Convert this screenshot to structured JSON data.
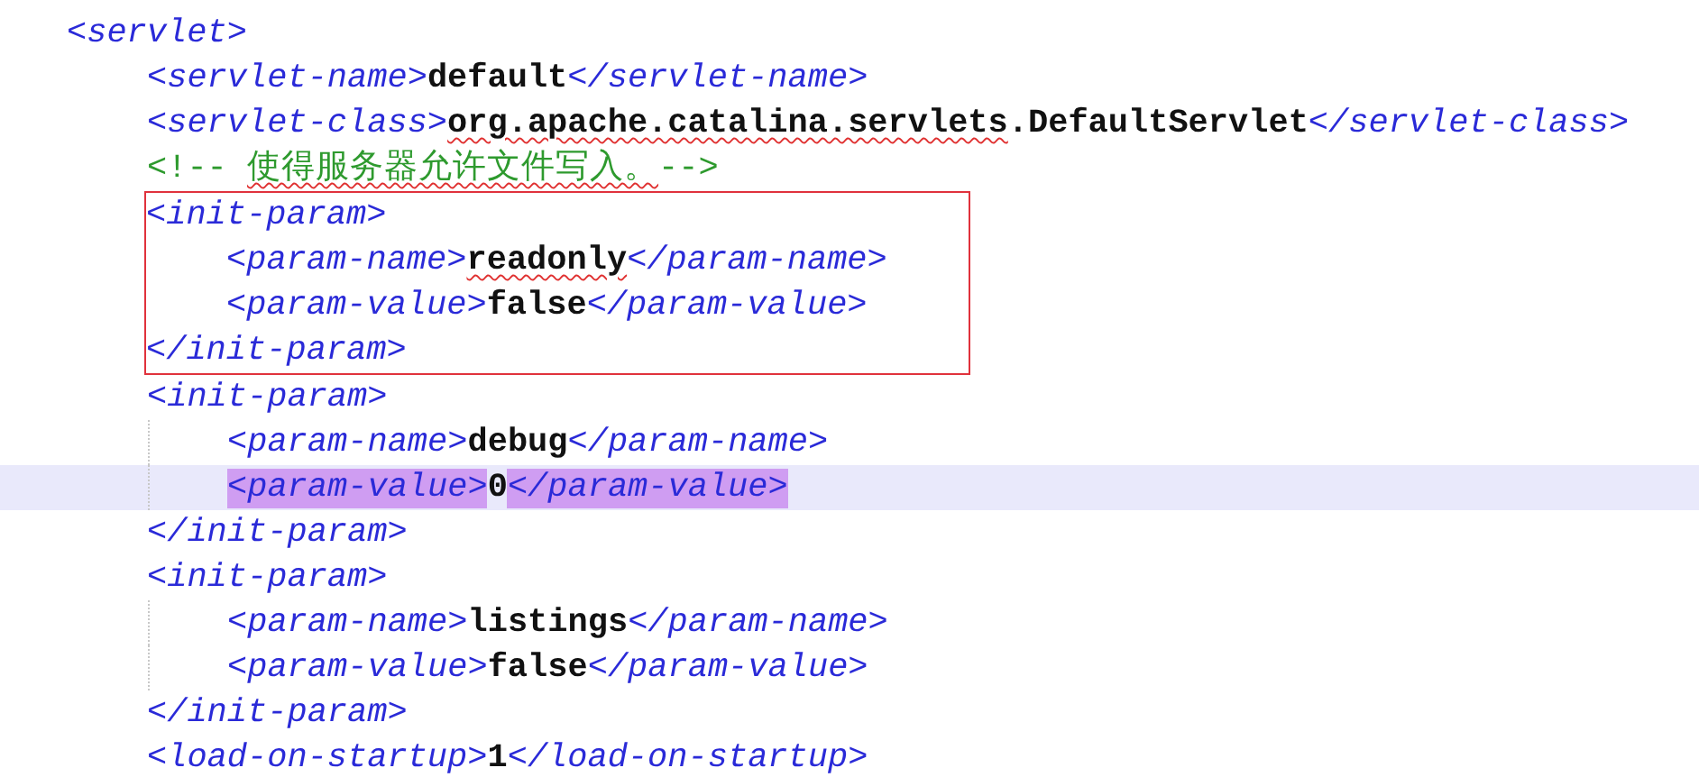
{
  "editor": {
    "lines": [
      {
        "kind": "code",
        "current": false,
        "tokens": [
          {
            "kind": "tag",
            "text": "<servlet>"
          }
        ],
        "children": [
          {
            "kind": "code",
            "current": false,
            "tokens": [
              {
                "kind": "tag",
                "text": "<servlet-name>"
              },
              {
                "kind": "text",
                "text": "default"
              },
              {
                "kind": "tag",
                "text": "</servlet-name>"
              }
            ]
          },
          {
            "kind": "code",
            "current": false,
            "tokens": [
              {
                "kind": "tag",
                "text": "<servlet-class>"
              },
              {
                "kind": "misspelled",
                "text": "org.apache.catalina.servlets"
              },
              {
                "kind": "text",
                "text": ".DefaultServlet"
              },
              {
                "kind": "tag",
                "text": "</servlet-class>"
              }
            ]
          },
          {
            "kind": "code",
            "current": false,
            "tokens": [
              {
                "kind": "comment",
                "text": "<!-- "
              },
              {
                "kind": "misspelled-comment",
                "text": "使得服务器允许文件写入。"
              },
              {
                "kind": "comment",
                "text": "-->"
              }
            ]
          },
          {
            "kind": "annotation",
            "lines": [
              {
                "kind": "code",
                "current": false,
                "tokens": [
                  {
                    "kind": "tag",
                    "text": "<init-param>"
                  }
                ],
                "children": [
                  {
                    "kind": "code",
                    "current": false,
                    "tokens": [
                      {
                        "kind": "tag",
                        "text": "<param-name>"
                      },
                      {
                        "kind": "misspelled",
                        "text": "readonly"
                      },
                      {
                        "kind": "tag",
                        "text": "</param-name>"
                      }
                    ]
                  },
                  {
                    "kind": "code",
                    "current": false,
                    "tokens": [
                      {
                        "kind": "tag",
                        "text": "<param-value>"
                      },
                      {
                        "kind": "text",
                        "text": "false"
                      },
                      {
                        "kind": "tag",
                        "text": "</param-value>"
                      }
                    ]
                  }
                ]
              },
              {
                "kind": "code",
                "current": false,
                "tokens": [
                  {
                    "kind": "tag",
                    "text": "</init-param>"
                  }
                ]
              }
            ]
          },
          {
            "kind": "code",
            "current": false,
            "tokens": [
              {
                "kind": "tag",
                "text": "<init-param>"
              }
            ],
            "children": [
              {
                "kind": "code",
                "current": false,
                "tokens": [
                  {
                    "kind": "tag",
                    "text": "<param-name>"
                  },
                  {
                    "kind": "text",
                    "text": "debug"
                  },
                  {
                    "kind": "tag",
                    "text": "</param-name>"
                  }
                ]
              },
              {
                "kind": "code",
                "current": true,
                "tokens": [
                  {
                    "kind": "matched-tag",
                    "text": "<param-value>"
                  },
                  {
                    "kind": "text",
                    "text": "0"
                  },
                  {
                    "kind": "matched-tag",
                    "text": "</param-value>"
                  }
                ]
              }
            ]
          },
          {
            "kind": "code",
            "current": false,
            "tokens": [
              {
                "kind": "tag",
                "text": "</init-param>"
              }
            ]
          },
          {
            "kind": "code",
            "current": false,
            "tokens": [
              {
                "kind": "tag",
                "text": "<init-param>"
              }
            ],
            "children": [
              {
                "kind": "code",
                "current": false,
                "tokens": [
                  {
                    "kind": "tag",
                    "text": "<param-name>"
                  },
                  {
                    "kind": "text",
                    "text": "listings"
                  },
                  {
                    "kind": "tag",
                    "text": "</param-name>"
                  }
                ]
              },
              {
                "kind": "code",
                "current": false,
                "tokens": [
                  {
                    "kind": "tag",
                    "text": "<param-value>"
                  },
                  {
                    "kind": "text",
                    "text": "false"
                  },
                  {
                    "kind": "tag",
                    "text": "</param-value>"
                  }
                ]
              }
            ]
          },
          {
            "kind": "code",
            "current": false,
            "tokens": [
              {
                "kind": "tag",
                "text": "</init-param>"
              }
            ]
          },
          {
            "kind": "code",
            "current": false,
            "tokens": [
              {
                "kind": "tag",
                "text": "<load-on-startup>"
              },
              {
                "kind": "text",
                "text": "1"
              },
              {
                "kind": "tag",
                "text": "</load-on-startup>"
              }
            ]
          }
        ]
      }
    ]
  }
}
